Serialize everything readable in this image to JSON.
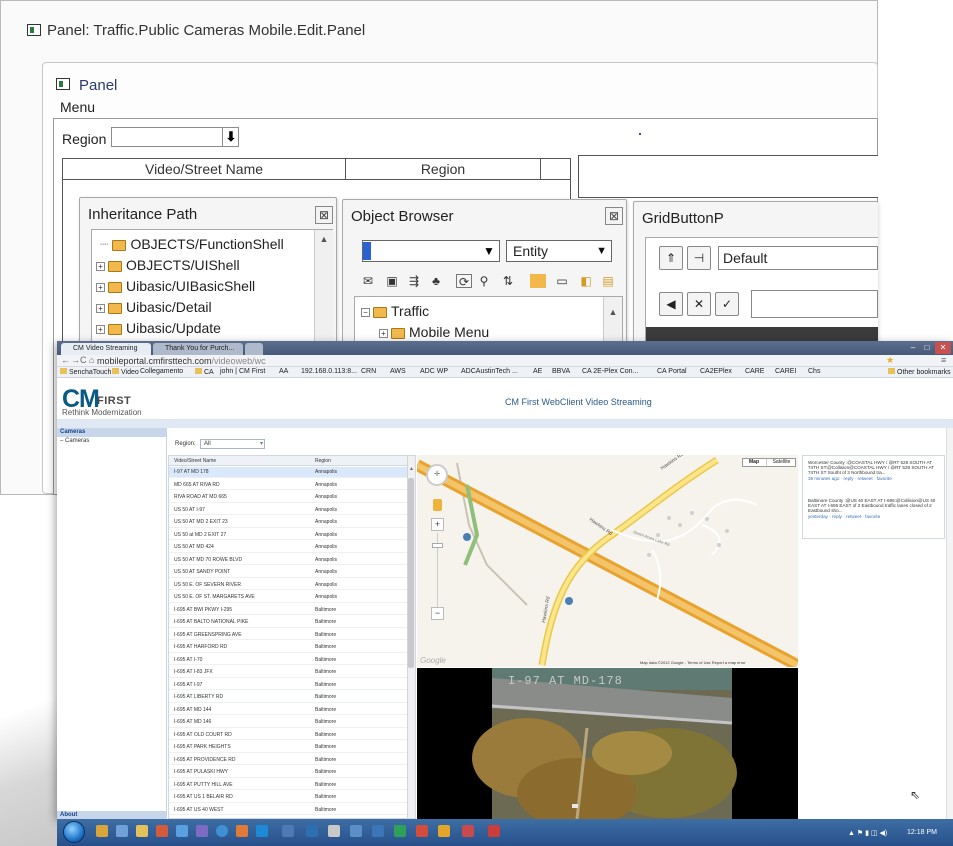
{
  "designer": {
    "title": "Panel: Traffic.Public Cameras Mobile.Edit.Panel",
    "panel_title": "Panel",
    "menu_label": "Menu",
    "region_label": "Region",
    "region_value": "",
    "grid_columns": [
      "Video/Street Name",
      "Region"
    ],
    "inheritance": {
      "title": "Inheritance Path",
      "items": [
        "OBJECTS/FunctionShell",
        "OBJECTS/UIShell",
        "Uibasic/UIBasicShell",
        "Uibasic/Detail",
        "Uibasic/Update"
      ]
    },
    "object_browser": {
      "title": "Object Browser",
      "combo_value": "",
      "type_value": "Entity",
      "tree": [
        "Traffic",
        "Mobile Menu"
      ]
    },
    "grid_button": {
      "title": "GridButtonP",
      "default_value": "Default"
    }
  },
  "browser": {
    "tabs": [
      "CM Video Streaming",
      "Thank You for Purch..."
    ],
    "url_host": "mobileportal.cmfirsttech.com",
    "url_path": "/videoweb/wc",
    "bookmarks": [
      "SenchaTouch",
      "Video",
      "Collegamento",
      "CA",
      "john | CM First",
      "AA",
      "192.168.0.113:8...",
      "CRN",
      "AWS",
      "ADC WP",
      "ADCAustinTech ...",
      "AE",
      "BBVA",
      "CA 2E-Plex Con...",
      "CA Portal",
      "CA2EPlex",
      "CARE",
      "CAREI",
      "Chs"
    ],
    "other_bookmarks": "Other bookmarks"
  },
  "app": {
    "logo_mark": "CM",
    "logo_word": "FIRST",
    "tagline": "Rethink Modernization",
    "title": "CM First WebClient Video Streaming",
    "nav_header": "Cameras",
    "nav_item": "Cameras",
    "nav_footer": "About",
    "region_label": "Region:",
    "region_value": "All",
    "columns": [
      "Video/Street Name",
      "Region"
    ],
    "cameras": [
      {
        "name": "I-97 AT MD 178",
        "region": "Annapolis"
      },
      {
        "name": "MD 665 AT RIVA RD",
        "region": "Annapolis"
      },
      {
        "name": "RIVA ROAD AT MD 665",
        "region": "Annapolis"
      },
      {
        "name": "US 50 AT I-97",
        "region": "Annapolis"
      },
      {
        "name": "US 50 AT MD 2 EXIT 23",
        "region": "Annapolis"
      },
      {
        "name": "US 50 at MD 2 EXIT 27",
        "region": "Annapolis"
      },
      {
        "name": "US 50 AT MD 424",
        "region": "Annapolis"
      },
      {
        "name": "US 50 AT MD 70 ROWE BLVD",
        "region": "Annapolis"
      },
      {
        "name": "US 50 AT SANDY POINT",
        "region": "Annapolis"
      },
      {
        "name": "US 50 E. OF SEVERN RIVER",
        "region": "Annapolis"
      },
      {
        "name": "US 50 E. OF ST. MARGARETS AVE",
        "region": "Annapolis"
      },
      {
        "name": "I-695 AT BWI PKWY I-295",
        "region": "Baltimore"
      },
      {
        "name": "I-695 AT BALTO NATIONAL PIKE",
        "region": "Baltimore"
      },
      {
        "name": "I-695 AT GREENSPRING AVE",
        "region": "Baltimore"
      },
      {
        "name": "I-695 AT HARFORD RD",
        "region": "Baltimore"
      },
      {
        "name": "I-695 AT I-70",
        "region": "Baltimore"
      },
      {
        "name": "I-695 AT I-83 JFX",
        "region": "Baltimore"
      },
      {
        "name": "I-695 AT I-97",
        "region": "Baltimore"
      },
      {
        "name": "I-695 AT LIBERTY RD",
        "region": "Baltimore"
      },
      {
        "name": "I-695 AT MD 144",
        "region": "Baltimore"
      },
      {
        "name": "I-695 AT MD 146",
        "region": "Baltimore"
      },
      {
        "name": "I-695 AT OLD COURT RD",
        "region": "Baltimore"
      },
      {
        "name": "I-695 AT PARK HEIGHTS",
        "region": "Baltimore"
      },
      {
        "name": "I-695 AT PROVIDENCE RD",
        "region": "Baltimore"
      },
      {
        "name": "I-695 AT PULASKI HWY",
        "region": "Baltimore"
      },
      {
        "name": "I-695 AT PUTTY HILL AVE",
        "region": "Baltimore"
      },
      {
        "name": "I-695 AT US 1 BELAIR RD",
        "region": "Baltimore"
      },
      {
        "name": "I-695 AT US 40 WEST",
        "region": "Baltimore"
      }
    ],
    "map": {
      "btn_map": "Map",
      "btn_satellite": "Satellite",
      "road_label_1": "Hawkins Rd",
      "road_label_2": "Green Acres Lake Rd",
      "road_label_3": "Hawkins Rd",
      "attribution": "Map data ©2012 Google - Terms of Use  Report a map error",
      "brand": "Google"
    },
    "video_caption": "I-97 AT MD-178",
    "tweets": [
      {
        "text": "Worcester County :@COASTAL HWY / @RT 528 SOUTH AT 74TH ST:@Collision@COASTAL HWY / @RT 528 SOUTH AT 74TH ST Southt of 3 Northbound tra...",
        "meta": "39 minutes ago · reply · retweet · favorite"
      },
      {
        "text": "Baltimore County :@US 40 EAST AT I-695:@Collision@US 40 EAST AT I-695 EAST of 2 Eastbound traffic lanes closed of 2 Eastbound sho...",
        "meta": "yesterday · reply · retweet · favorite"
      }
    ]
  },
  "taskbar": {
    "clock": "12:18 PM"
  },
  "colors": {
    "accent": "#0a5a86",
    "selected_row": "#d9e8fb",
    "highway": "#e9a22e"
  }
}
